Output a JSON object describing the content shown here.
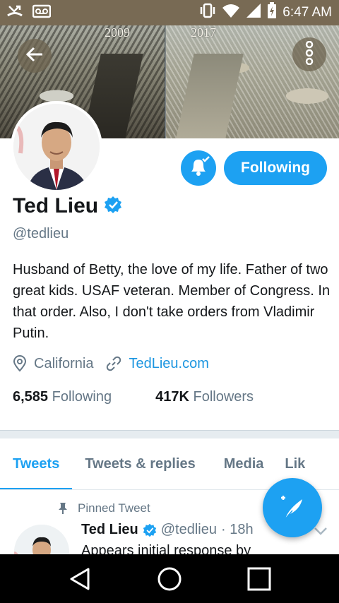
{
  "status_bar": {
    "time": "6:47 AM",
    "icons": [
      "missed-call-icon",
      "voicemail-icon",
      "vibrate-icon",
      "wifi-icon",
      "signal-icon",
      "battery-icon"
    ]
  },
  "banner": {
    "year_left": "2009",
    "year_right": "2017"
  },
  "profile": {
    "name": "Ted Lieu",
    "handle": "@tedlieu",
    "verified": true,
    "bio": "Husband of Betty, the love of my life. Father of two great kids. USAF veteran. Member of Congress. In that order. Also, I don't take orders from Vladimir Putin.",
    "location": "California",
    "website": "TedLieu.com",
    "following_count": "6,585",
    "following_label": "Following",
    "followers_count": "417K",
    "followers_label": "Followers"
  },
  "actions": {
    "follow_label": "Following"
  },
  "tabs": [
    {
      "label": "Tweets",
      "active": true
    },
    {
      "label": "Tweets & replies",
      "active": false
    },
    {
      "label": "Media",
      "active": false
    },
    {
      "label": "Lik",
      "active": false
    }
  ],
  "pinned_tweet": {
    "pinned_label": "Pinned Tweet",
    "name": "Ted Lieu",
    "handle": "@tedlieu",
    "time": "· 18h",
    "text": "Appears initial response by"
  },
  "colors": {
    "accent": "#1da1f2",
    "status_bar": "#786a54"
  }
}
